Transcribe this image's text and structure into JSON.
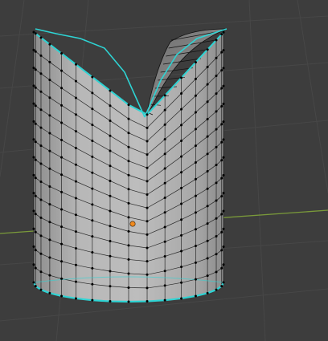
{
  "viewport": {
    "editor_mode": "Edit Mode",
    "object_type": "mesh",
    "shape": "cut-cylinder"
  },
  "colors": {
    "background": "#3d3d3d",
    "grid_line": "#484848",
    "x_axis": "#7a9a3a",
    "mesh_face": "#b5b5b5",
    "mesh_face_shadow": "#8a8a8a",
    "wire": "#111111",
    "vertex": "#000000",
    "selected_edge": "#2ed4d4",
    "origin": "#f08a1f"
  },
  "icons": [
    "object-origin-icon"
  ]
}
